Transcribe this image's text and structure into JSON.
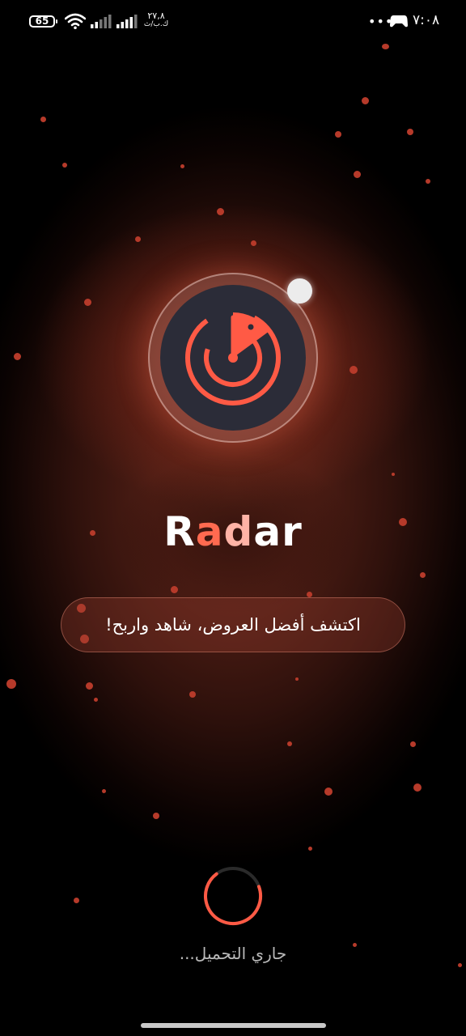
{
  "status_bar": {
    "battery": "65",
    "net_speed_value": "٢٧,٨",
    "net_speed_unit": "ك.ب/ث",
    "time": "٧:٠٨",
    "icons": [
      "wifi-icon",
      "signal-icon",
      "signal-icon",
      "more-dots-icon",
      "game-controller-icon"
    ]
  },
  "logo": {
    "icon": "radar-icon",
    "accent_color": "#ff5a45"
  },
  "app": {
    "title_parts": [
      "R",
      "a",
      "d",
      "a",
      "r"
    ],
    "tagline": "اكتشف أفضل العروض، شاهد واربح!"
  },
  "loading": {
    "label": "جاري التحميل..."
  },
  "colors": {
    "accent": "#ff5a45",
    "background": "#000000",
    "logo_bg": "#2b2c38"
  }
}
